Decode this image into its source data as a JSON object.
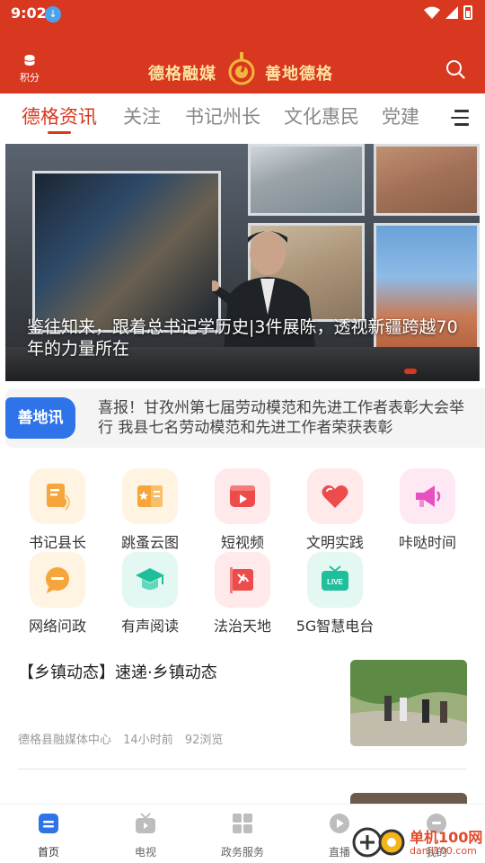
{
  "status_bar": {
    "time": "9:02"
  },
  "header": {
    "points_label": "积分",
    "brand_left": "德格融媒",
    "brand_right": "善地德格"
  },
  "tabs": [
    {
      "label": "德格资讯",
      "active": true
    },
    {
      "label": "关注",
      "active": false
    },
    {
      "label": "书记州长",
      "active": false
    },
    {
      "label": "文化惠民",
      "active": false
    },
    {
      "label": "党建",
      "active": false
    }
  ],
  "banner": {
    "caption": "鉴往知来，跟着总书记学历史|3件展陈，透视新疆跨越70年的力量所在"
  },
  "notice": {
    "tag": "善地讯",
    "text": "喜报！甘孜州第七届劳动模范和先进工作者表彰大会举行 我县七名劳动模范和先进工作者荣获表彰"
  },
  "grid": [
    {
      "label": "书记县长",
      "icon": "document-broadcast-icon",
      "color": "#f39a2b"
    },
    {
      "label": "跳蚤云图",
      "icon": "star-book-icon",
      "color": "#f39a2b"
    },
    {
      "label": "短视频",
      "icon": "video-play-icon",
      "color": "#ea4a4a"
    },
    {
      "label": "文明实践",
      "icon": "heart-icon",
      "color": "#ea4a4a"
    },
    {
      "label": "咔哒时间",
      "icon": "megaphone-icon",
      "color": "#e24cbf"
    },
    {
      "label": "网络问政",
      "icon": "chat-bubble-icon",
      "color": "#f39a2b"
    },
    {
      "label": "有声阅读",
      "icon": "graduation-cap-icon",
      "color": "#1fbf9c"
    },
    {
      "label": "法治天地",
      "icon": "party-flag-icon",
      "color": "#ea4a4a"
    },
    {
      "label": "5G智慧电台",
      "icon": "live-tv-icon",
      "color": "#1fbf9c"
    }
  ],
  "news": [
    {
      "title": "【乡镇动态】速递·乡镇动态",
      "source": "德格县融媒体中心",
      "time": "14小时前",
      "views": "92浏览"
    }
  ],
  "bottom_nav": [
    {
      "label": "首页",
      "icon": "home-icon",
      "active": true
    },
    {
      "label": "电视",
      "icon": "tv-icon",
      "active": false
    },
    {
      "label": "政务服务",
      "icon": "grid-apps-icon",
      "active": false
    },
    {
      "label": "直播",
      "icon": "play-circle-icon",
      "active": false
    },
    {
      "label": "我的",
      "icon": "user-icon",
      "active": false
    }
  ],
  "watermark": {
    "text": "单机100网",
    "url": "danji100.com"
  },
  "colors": {
    "brand_red": "#d8381f",
    "notice_blue": "#2e73e8"
  }
}
